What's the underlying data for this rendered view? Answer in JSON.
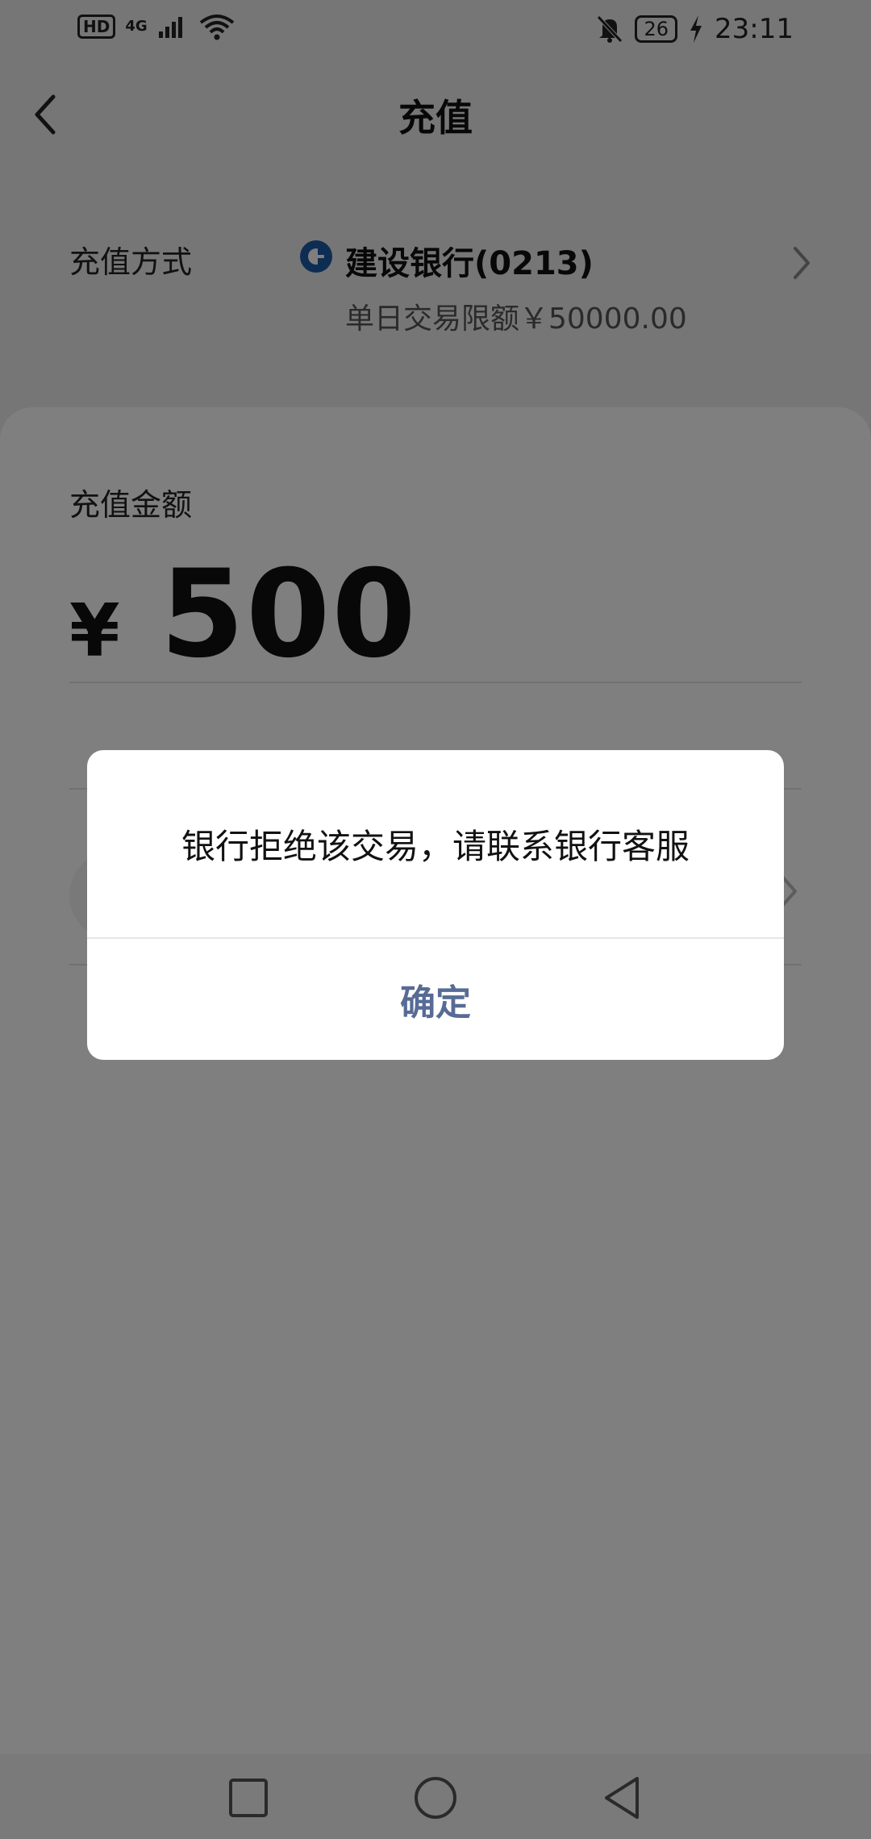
{
  "status_bar": {
    "hd": "HD",
    "network": "4G",
    "battery": "26",
    "time": "23:11",
    "icons": [
      "hd-icon",
      "signal-icon",
      "wifi-icon",
      "bell-off-icon",
      "battery-icon",
      "charging-icon"
    ]
  },
  "header": {
    "title": "充值",
    "back_icon": "chevron-left-icon"
  },
  "payment_method": {
    "label": "充值方式",
    "bank_name": "建设银行(0213)",
    "limit": "单日交易限额￥50000.00",
    "bank_logo_icon": "ccb-bank-logo-icon",
    "chevron_icon": "chevron-right-icon"
  },
  "amount": {
    "label": "充值金额",
    "currency": "¥",
    "value": "500"
  },
  "dialog": {
    "message": "银行拒绝该交易，请联系银行客服",
    "confirm_label": "确定",
    "confirm_color": "#576b95"
  },
  "nav_bar": {
    "icons": [
      "recents-square-icon",
      "home-circle-icon",
      "back-triangle-icon"
    ]
  },
  "colors": {
    "overlay": "rgba(0,0,0,0.5)",
    "text_primary": "#111111",
    "text_secondary": "#555555"
  }
}
